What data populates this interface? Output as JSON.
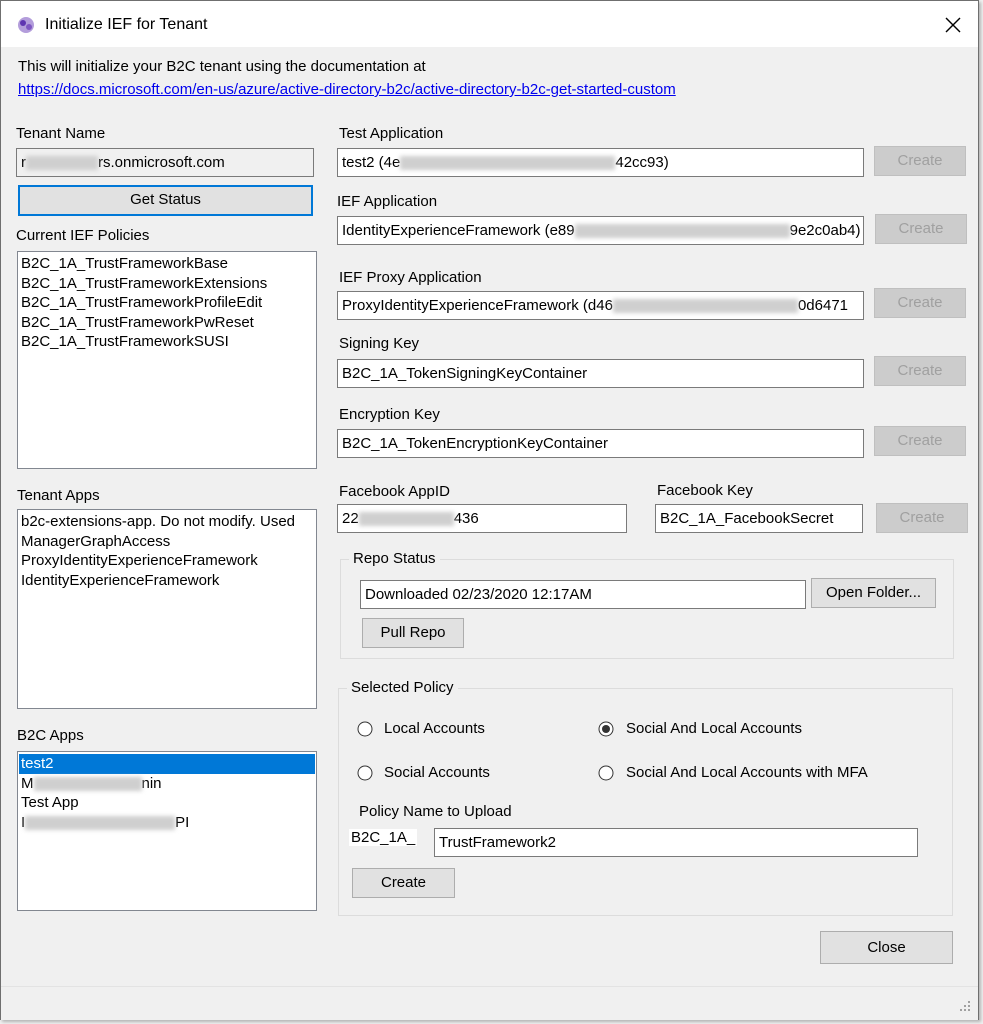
{
  "window": {
    "title": "Initialize IEF for Tenant",
    "close_glyph": "✕"
  },
  "intro": {
    "text": "This will initialize your B2C tenant using the documentation at",
    "link": "https://docs.microsoft.com/en-us/azure/active-directory-b2c/active-directory-b2c-get-started-custom"
  },
  "tenant": {
    "label": "Tenant Name",
    "value_prefix": "r",
    "value_suffix": "rs.onmicrosoft.com",
    "get_status_label": "Get Status"
  },
  "policies": {
    "label": "Current IEF Policies",
    "items": [
      "B2C_1A_TrustFrameworkBase",
      "B2C_1A_TrustFrameworkExtensions",
      "B2C_1A_TrustFrameworkProfileEdit",
      "B2C_1A_TrustFrameworkPwReset",
      "B2C_1A_TrustFrameworkSUSI"
    ]
  },
  "tenant_apps": {
    "label": "Tenant Apps",
    "items": [
      "b2c-extensions-app. Do not modify. Used",
      "ManagerGraphAccess",
      "ProxyIdentityExperienceFramework",
      "IdentityExperienceFramework"
    ]
  },
  "b2c_apps": {
    "label": "B2C Apps",
    "items": [
      {
        "prefix": "test2",
        "suffix": "",
        "selected": true
      },
      {
        "prefix": "M",
        "suffix": "nin",
        "selected": false
      },
      {
        "prefix": "Test App",
        "suffix": "",
        "selected": false
      },
      {
        "prefix": "I",
        "suffix": "PI",
        "selected": false
      }
    ]
  },
  "test_app": {
    "label": "Test Application",
    "value_prefix": "test2 (4e",
    "value_suffix": "42cc93)",
    "create_label": "Create"
  },
  "ief_app": {
    "label": "IEF Application",
    "value_prefix": "IdentityExperienceFramework (e89",
    "value_suffix": "9e2c0ab4)",
    "create_label": "Create"
  },
  "ief_proxy_app": {
    "label": "IEF Proxy Application",
    "value_prefix": "ProxyIdentityExperienceFramework (d46",
    "value_suffix": "0d6471",
    "create_label": "Create"
  },
  "signing_key": {
    "label": "Signing Key",
    "value": "B2C_1A_TokenSigningKeyContainer",
    "create_label": "Create"
  },
  "encryption_key": {
    "label": "Encryption Key",
    "value": "B2C_1A_TokenEncryptionKeyContainer",
    "create_label": "Create"
  },
  "facebook": {
    "appid_label": "Facebook AppID",
    "appid_prefix": "22",
    "appid_suffix": "436",
    "key_label": "Facebook Key",
    "key_value": "B2C_1A_FacebookSecret",
    "create_label": "Create"
  },
  "repo": {
    "label": "Repo Status",
    "status": "Downloaded 02/23/2020 12:17AM",
    "open_folder_label": "Open Folder...",
    "pull_label": "Pull Repo"
  },
  "selected_policy": {
    "label": "Selected Policy",
    "options": [
      {
        "label": "Local Accounts",
        "checked": false
      },
      {
        "label": "Social And Local Accounts",
        "checked": true
      },
      {
        "label": "Social Accounts",
        "checked": false
      },
      {
        "label": "Social And Local Accounts with MFA",
        "checked": false
      }
    ],
    "policy_name_label": "Policy Name to Upload",
    "prefix": "B2C_1A_",
    "policy_name_value": "TrustFramework2",
    "create_label": "Create"
  },
  "close_label": "Close",
  "colors": {
    "selection": "#0078d7",
    "link": "#0000ee",
    "focus": "#0078d7"
  }
}
